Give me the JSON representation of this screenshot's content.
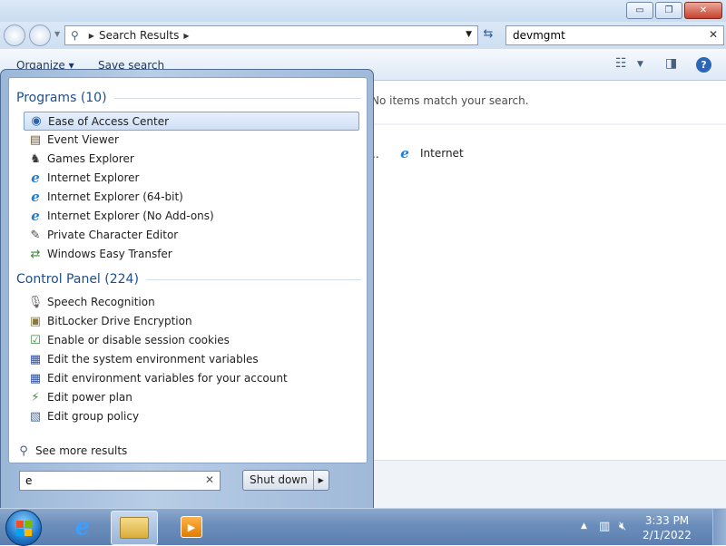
{
  "window": {
    "controls": {
      "minimize": "▭",
      "maximize": "❐",
      "close": "✕"
    }
  },
  "address": {
    "path": "Search Results",
    "search_value": "devmgmt"
  },
  "toolbar": {
    "organize": "Organize ▾",
    "save_search": "Save search"
  },
  "content": {
    "no_items": "No items match your search.",
    "ellipsis": "..",
    "internet": "Internet"
  },
  "startmenu": {
    "programs_header": "Programs (10)",
    "programs": [
      {
        "label": "Ease of Access Center",
        "icon": "ease-of-access-icon"
      },
      {
        "label": "Event Viewer",
        "icon": "event-viewer-icon"
      },
      {
        "label": "Games Explorer",
        "icon": "games-explorer-icon"
      },
      {
        "label": "Internet Explorer",
        "icon": "internet-explorer-icon"
      },
      {
        "label": "Internet Explorer (64-bit)",
        "icon": "internet-explorer-icon"
      },
      {
        "label": "Internet Explorer (No Add-ons)",
        "icon": "internet-explorer-icon"
      },
      {
        "label": "Private Character Editor",
        "icon": "character-editor-icon"
      },
      {
        "label": "Windows Easy Transfer",
        "icon": "easy-transfer-icon"
      }
    ],
    "control_panel_header": "Control Panel (224)",
    "control_panel": [
      {
        "label": "Speech Recognition",
        "icon": "microphone-icon"
      },
      {
        "label": "BitLocker Drive Encryption",
        "icon": "bitlocker-icon"
      },
      {
        "label": "Enable or disable session cookies",
        "icon": "cookies-icon"
      },
      {
        "label": "Edit the system environment variables",
        "icon": "system-properties-icon"
      },
      {
        "label": "Edit environment variables for your account",
        "icon": "system-properties-icon"
      },
      {
        "label": "Edit power plan",
        "icon": "power-plan-icon"
      },
      {
        "label": "Edit group policy",
        "icon": "group-policy-icon"
      }
    ],
    "see_more": "See more results",
    "search_value": "e",
    "shutdown": "Shut down"
  },
  "taskbar": {
    "time": "3:33 PM",
    "date": "2/1/2022"
  }
}
